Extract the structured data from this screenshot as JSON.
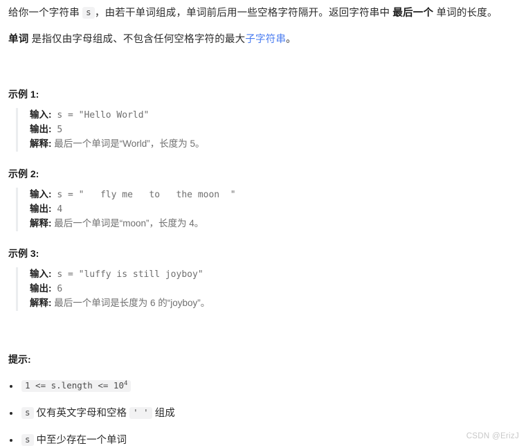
{
  "problem": {
    "paragraph1": {
      "prefix": "给你一个字符串 ",
      "code_s": "s",
      "middle": "，由若干单词组成，单词前后用一些空格字符隔开。返回字符串中 ",
      "bold": "最后一个",
      "suffix": " 单词的长度。"
    },
    "paragraph2": {
      "bold": "单词",
      "middle": " 是指仅由字母组成、不包含任何空格字符的最大",
      "link": "子字符串",
      "suffix": "。"
    }
  },
  "examples": [
    {
      "heading": "示例 1:",
      "input_label": "输入:",
      "input_value": " s = \"Hello World\"",
      "output_label": "输出:",
      "output_value": " 5",
      "explain_label": "解释:",
      "explain_value": " 最后一个单词是“World”，长度为 5。"
    },
    {
      "heading": "示例 2:",
      "input_label": "输入:",
      "input_value": " s = \"   fly me   to   the moon  \"",
      "output_label": "输出:",
      "output_value": " 4",
      "explain_label": "解释:",
      "explain_value": " 最后一个单词是“moon”，长度为 4。"
    },
    {
      "heading": "示例 3:",
      "input_label": "输入:",
      "input_value": " s = \"luffy is still joyboy\"",
      "output_label": "输出:",
      "output_value": " 6",
      "explain_label": "解释:",
      "explain_value": " 最后一个单词是长度为 6 的“joyboy”。"
    }
  ],
  "hints": {
    "heading": "提示:",
    "items": [
      {
        "code_before": "1 <= s.length <= 10",
        "code_sup": "4",
        "text_after": "",
        "code_after": ""
      },
      {
        "code_before": "s",
        "code_sup": "",
        "text_after": " 仅有英文字母和空格 ",
        "code_after": "' '",
        "text_end": " 组成"
      },
      {
        "code_before": "s",
        "code_sup": "",
        "text_after": " 中至少存在一个单词",
        "code_after": ""
      }
    ]
  },
  "watermark": "CSDN @ErizJ",
  "colors": {
    "link": "#4a7cf0",
    "code_text": "#6f6f6f",
    "chip_bg": "#f2f2f3",
    "border": "#ebedef",
    "watermark": "#c8c8c8"
  }
}
